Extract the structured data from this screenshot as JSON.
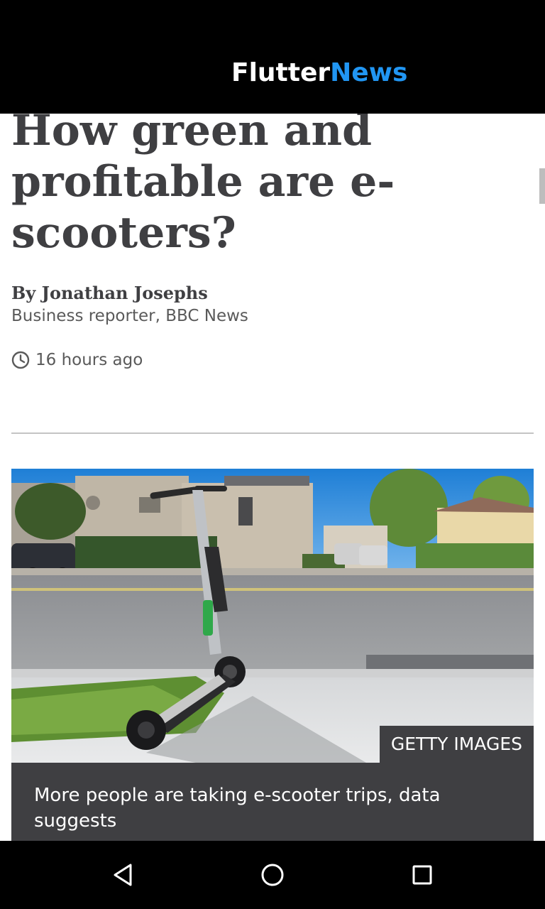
{
  "app_bar": {
    "title_part1": "Flutter",
    "title_part2": "News",
    "title_color": "#ffffff",
    "accent_color": "#2196f3"
  },
  "article": {
    "headline": "How green and profitable are e-scooters?",
    "author": "By Jonathan Josephs",
    "author_role": "Business reporter, BBC News",
    "timestamp": "16 hours ago",
    "image": {
      "description_icon": "scooter-photo",
      "credit": "GETTY IMAGES"
    },
    "caption": "More people are taking e-scooter trips, data suggests"
  },
  "nav_bar": {
    "back_icon": "triangle-back-icon",
    "home_icon": "circle-home-icon",
    "recent_icon": "square-recents-icon"
  },
  "colors": {
    "headline": "#3f3f42",
    "caption_bg": "#3f3f42",
    "secondary_text": "#5a5a5a"
  }
}
